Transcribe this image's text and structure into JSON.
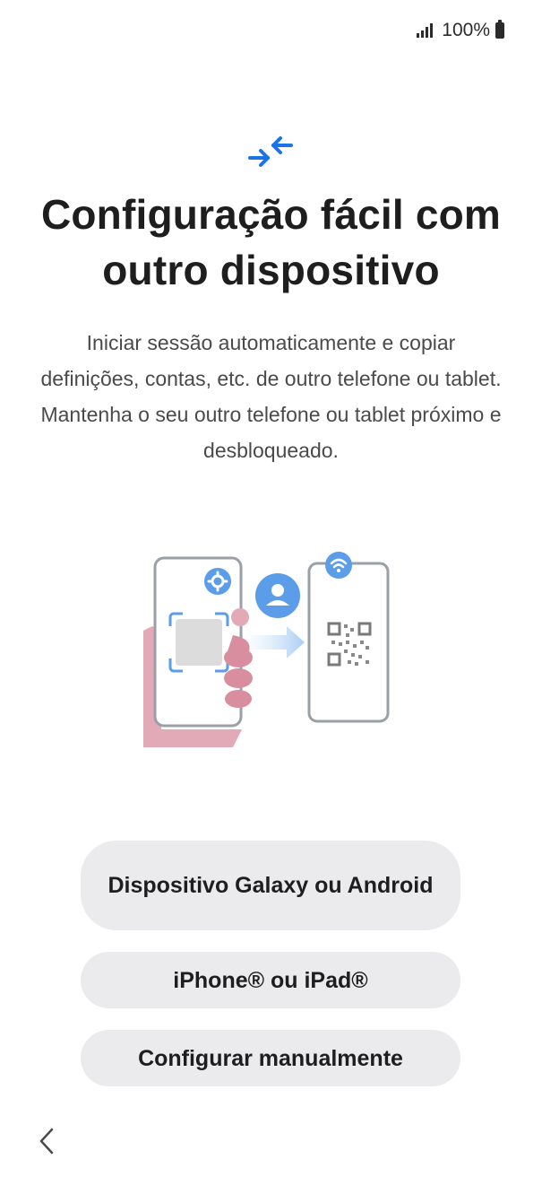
{
  "status_bar": {
    "battery_text": "100%"
  },
  "header": {
    "icon": "transfer-arrows-icon",
    "title": "Configuração fácil com outro dispositivo",
    "description": "Iniciar sessão automaticamente e copiar definições, contas, etc. de outro telefone ou tablet. Mantenha o seu outro telefone ou tablet próximo e desbloqueado."
  },
  "illustration": {
    "icons": [
      "phone-in-hand-icon",
      "settings-gear-icon",
      "user-avatar-icon",
      "arrow-right-icon",
      "wifi-icon",
      "qr-code-icon"
    ]
  },
  "options": [
    {
      "label": "Dispositivo Galaxy ou Android"
    },
    {
      "label": "iPhone® ou iPad®"
    },
    {
      "label": "Configurar manualmente"
    }
  ],
  "nav": {
    "back_icon": "chevron-left-icon"
  },
  "colors": {
    "accent": "#1a73e8",
    "button_bg": "#ebebed",
    "illustration_blue": "#5b9de8",
    "hand_pink": "#e2a9b7"
  }
}
